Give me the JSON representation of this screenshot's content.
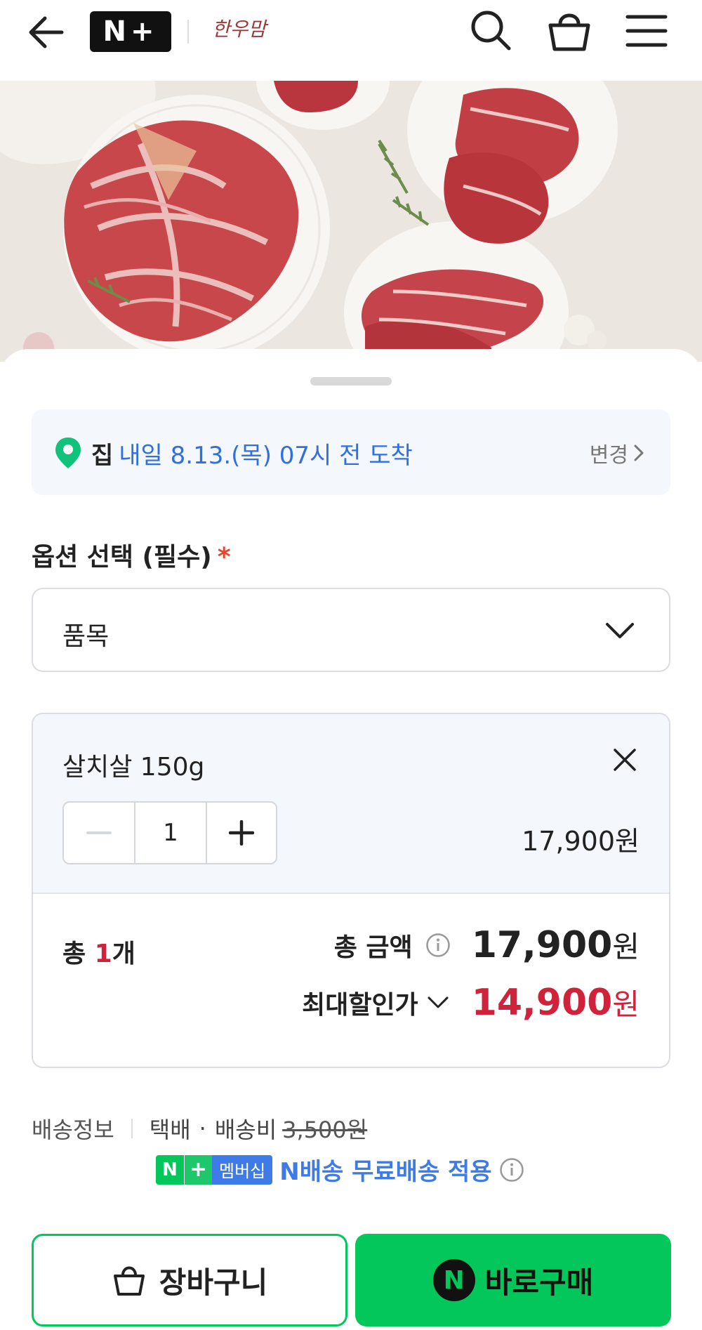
{
  "header": {
    "logo_text": "N+",
    "brand_logo_text": "한우맘"
  },
  "delivery": {
    "label": "집",
    "eta": "내일 8.13.(목) 07시 전 도착",
    "change_label": "변경"
  },
  "option": {
    "title": "옵션 선택 (필수)",
    "required_mark": "*",
    "select_placeholder": "품목"
  },
  "item": {
    "name": "살치살 150g",
    "quantity": "1",
    "price": "17,900원"
  },
  "totals": {
    "count_prefix": "총 ",
    "count_value": "1",
    "count_suffix": "개",
    "total_label": "총 금액",
    "total_amount": "17,900",
    "discount_label": "최대할인가",
    "discount_amount": "14,900",
    "currency": "원"
  },
  "shipping": {
    "label": "배송정보",
    "method": "택배",
    "dot": "·",
    "fee_label": "배송비",
    "fee_original": "3,500원"
  },
  "membership": {
    "badge_n": "N",
    "badge_plus": "+",
    "badge_text": "멤버십",
    "text": "N배송 무료배송 적용"
  },
  "actions": {
    "cart_label": "장바구니",
    "buy_label": "바로구매",
    "npay_letter": "N"
  },
  "colors": {
    "accent_green": "#03c75a",
    "eta_blue": "#2f6fe0",
    "price_red": "#d0233b",
    "required_red": "#e8452f",
    "member_blue": "#3e7be6"
  },
  "icons": [
    "back-arrow-icon",
    "search-icon",
    "shopping-bag-icon",
    "hamburger-menu-icon",
    "location-pin-icon",
    "chevron-right-icon",
    "chevron-down-icon",
    "close-icon",
    "minus-icon",
    "plus-icon",
    "info-icon",
    "npay-icon"
  ]
}
